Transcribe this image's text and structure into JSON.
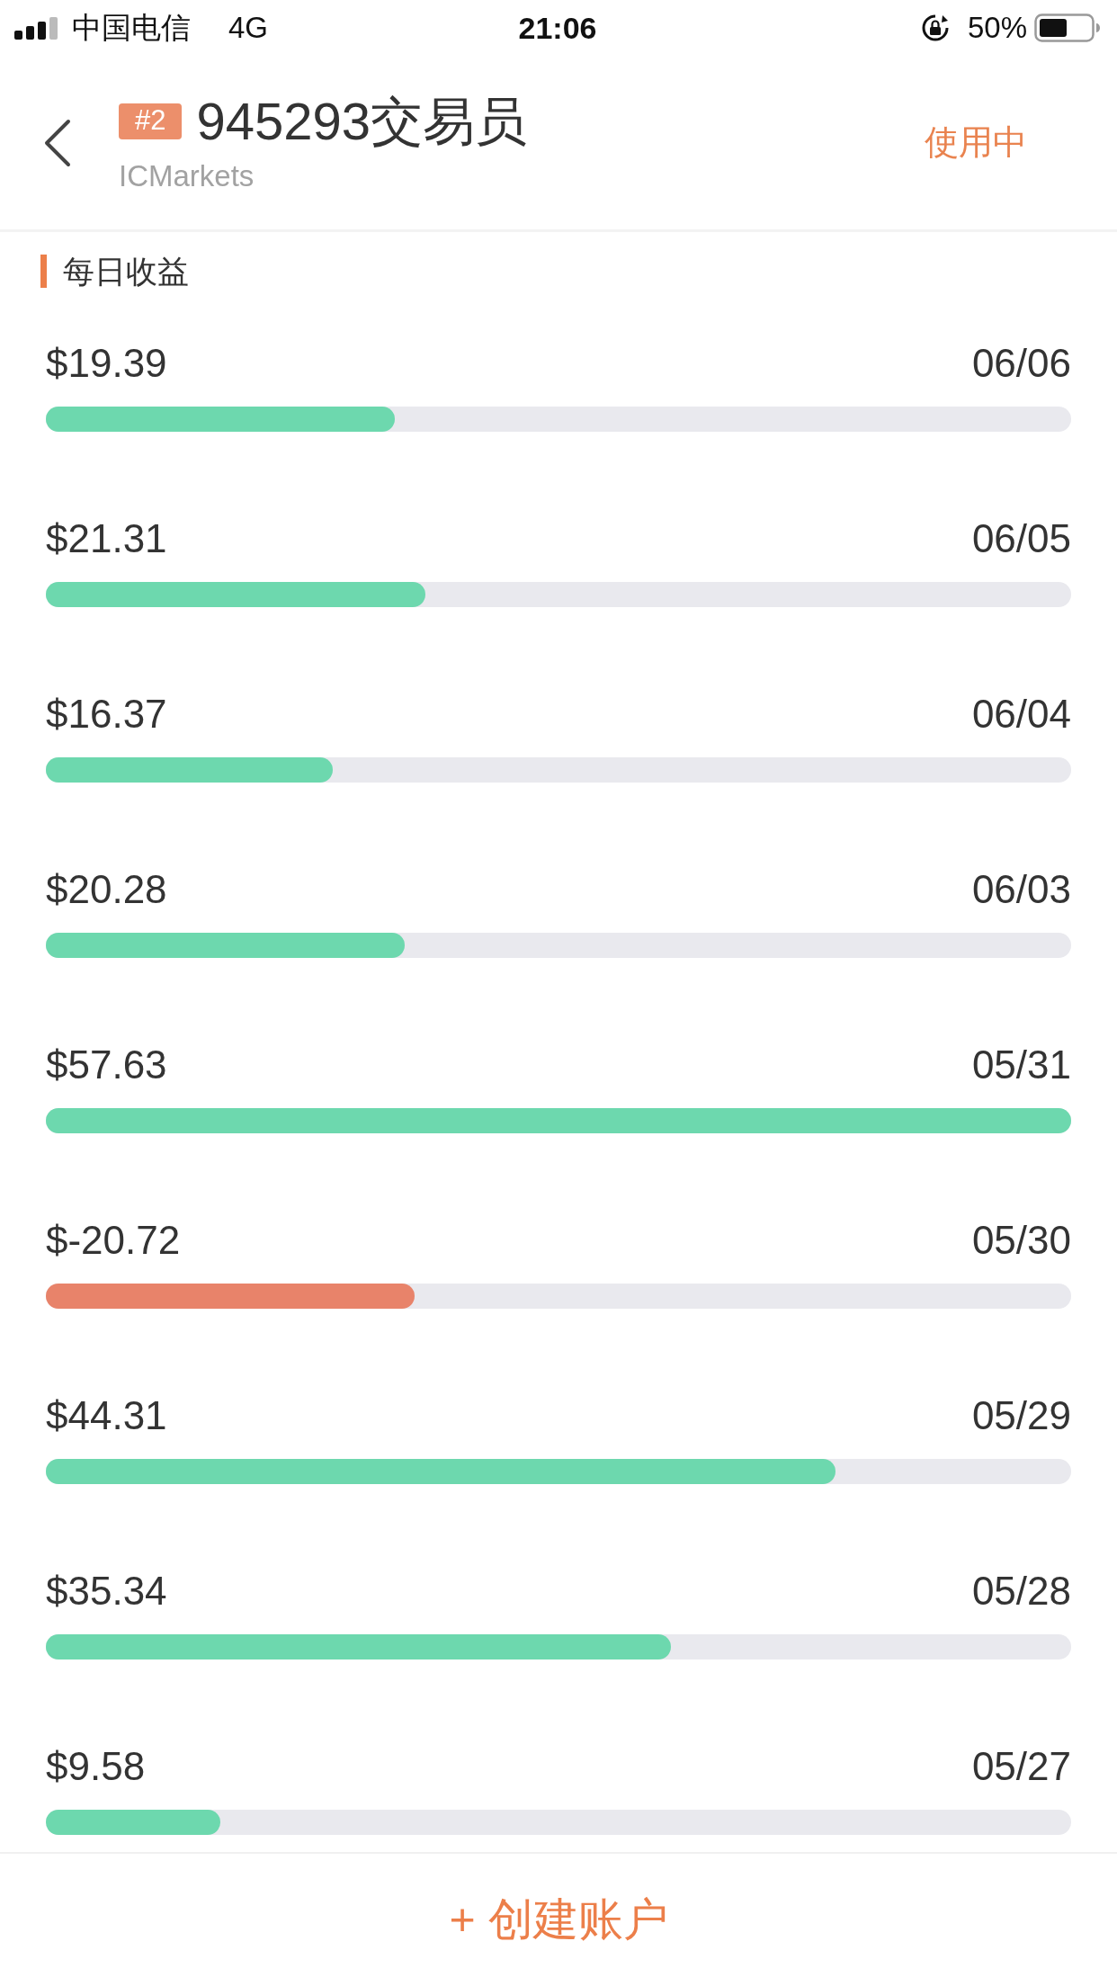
{
  "status_bar": {
    "carrier": "中国电信",
    "network": "4G",
    "time": "21:06",
    "battery": "50%"
  },
  "header": {
    "badge": "#2",
    "title": "945293交易员",
    "subtitle": "ICMarkets",
    "status": "使用中"
  },
  "section": {
    "title": "每日收益"
  },
  "rows": [
    {
      "amount": "$19.39",
      "date": "06/06",
      "level": 0.34,
      "color": "#6dd8ae"
    },
    {
      "amount": "$21.31",
      "date": "06/05",
      "level": 0.37,
      "color": "#6dd8ae"
    },
    {
      "amount": "$16.37",
      "date": "06/04",
      "level": 0.28,
      "color": "#6dd8ae"
    },
    {
      "amount": "$20.28",
      "date": "06/03",
      "level": 0.35,
      "color": "#6dd8ae"
    },
    {
      "amount": "$57.63",
      "date": "05/31",
      "level": 1,
      "color": "#6dd8ae"
    },
    {
      "amount": "$-20.72",
      "date": "05/30",
      "level": 0.36,
      "color": "#e8836a"
    },
    {
      "amount": "$44.31",
      "date": "05/29",
      "level": 0.77,
      "color": "#6dd8ae"
    },
    {
      "amount": "$35.34",
      "date": "05/28",
      "level": 0.61,
      "color": "#6dd8ae"
    },
    {
      "amount": "$9.58",
      "date": "05/27",
      "level": 0.17,
      "color": "#6dd8ae"
    }
  ],
  "footer": {
    "button": "+ 创建账户"
  }
}
